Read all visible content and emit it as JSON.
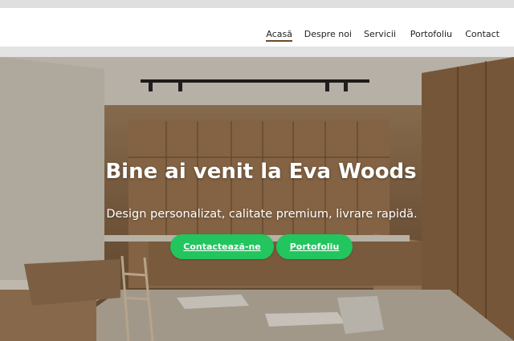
{
  "nav": {
    "items": [
      {
        "label": "Acasă",
        "active": true
      },
      {
        "label": "Despre noi",
        "active": false
      },
      {
        "label": "Servicii",
        "active": false
      },
      {
        "label": "Portofoliu",
        "active": false
      },
      {
        "label": "Contact",
        "active": false
      }
    ]
  },
  "hero": {
    "title": "Bine ai venit la Eva Woods",
    "subtitle": "Design personalizat, calitate premium, livrare rapidă.",
    "cta_primary": "Contactează-ne",
    "cta_secondary": "Portofoliu"
  },
  "colors": {
    "accent": "#22c55e",
    "active_underline": "#6b4a2a"
  }
}
